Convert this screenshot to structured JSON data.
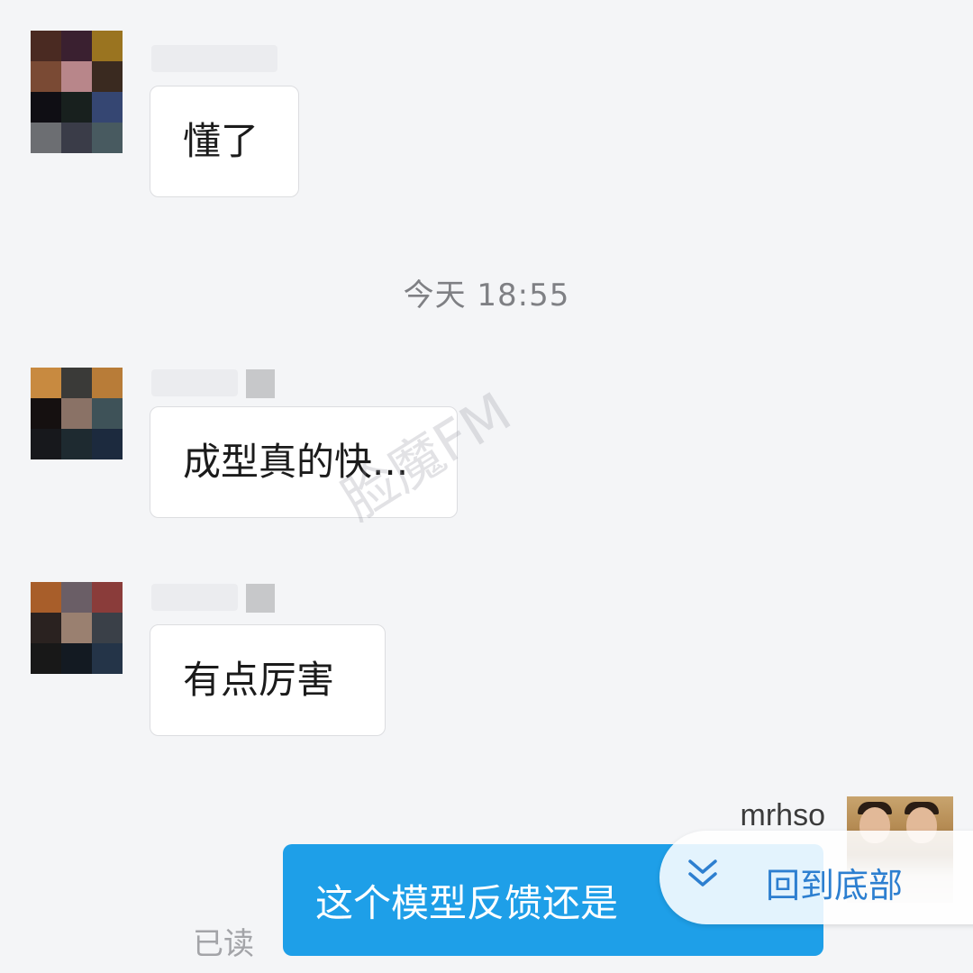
{
  "messages": [
    {
      "text": "懂了"
    },
    {
      "text": "成型真的快..."
    },
    {
      "text": "有点厉害"
    }
  ],
  "timestamp": "今天  18:55",
  "watermark": "脸魔FM",
  "me": {
    "name": "mrhso",
    "message": "这个模型反馈还是",
    "status": "已读"
  },
  "back_to_bottom": {
    "label": "回到底部",
    "icon": "double-chevron-down-icon"
  },
  "colors": {
    "background": "#f4f5f7",
    "my_bubble": "#1e9fe8",
    "accent_link": "#2d7fd0"
  }
}
